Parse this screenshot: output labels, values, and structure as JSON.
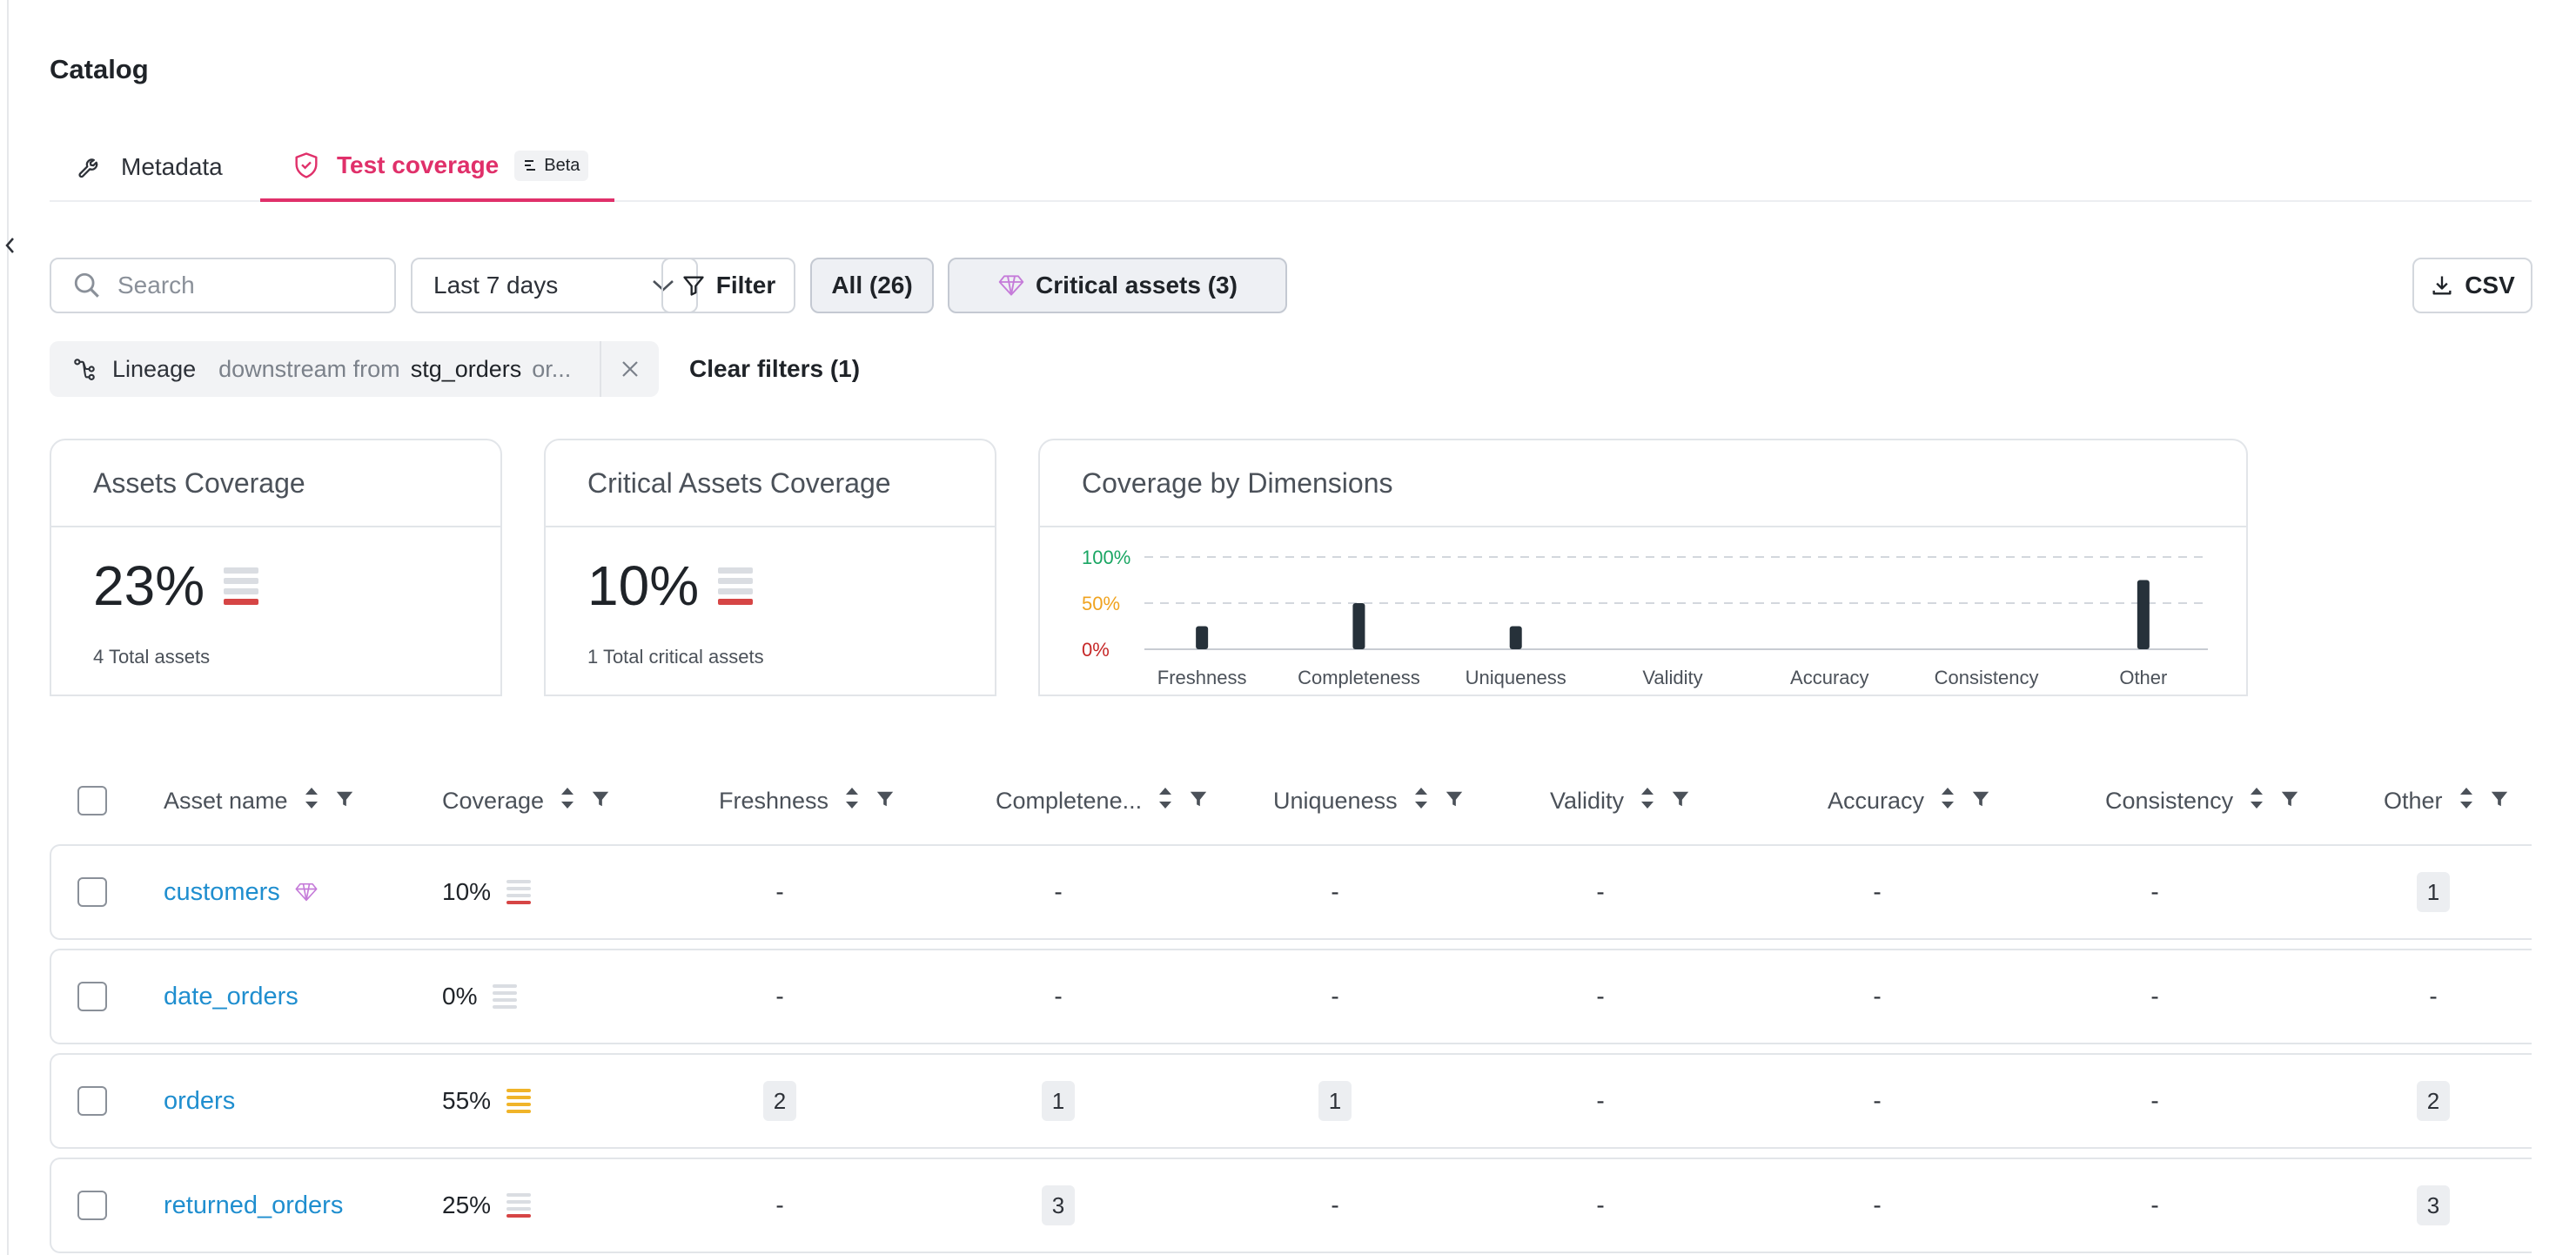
{
  "page": {
    "title": "Catalog"
  },
  "tabs": [
    {
      "label": "Metadata",
      "icon": "wrench-icon"
    },
    {
      "label": "Test coverage",
      "icon": "shield-check-icon",
      "badge": "Beta",
      "active": true
    }
  ],
  "toolbar": {
    "search_placeholder": "Search",
    "date_range": "Last 7 days",
    "filter_label": "Filter",
    "all_label": "All (26)",
    "critical_label": "Critical assets (3)",
    "csv_label": "CSV"
  },
  "active_filter": {
    "key": "Lineage",
    "relation": "downstream from",
    "value": "stg_orders",
    "more": "or...",
    "clear_label": "Clear filters (1)"
  },
  "cards": {
    "assets": {
      "title": "Assets Coverage",
      "value": "23%",
      "subtitle": "4 Total assets",
      "level": 0.23
    },
    "critical": {
      "title": "Critical Assets Coverage",
      "value": "10%",
      "subtitle": "1 Total critical assets",
      "level": 0.1
    },
    "dimensions": {
      "title": "Coverage by Dimensions"
    }
  },
  "chart_data": {
    "type": "bar",
    "categories": [
      "Freshness",
      "Completeness",
      "Uniqueness",
      "Validity",
      "Accuracy",
      "Consistency",
      "Other"
    ],
    "values": [
      25,
      50,
      25,
      0,
      0,
      0,
      75
    ],
    "ylim": [
      0,
      100
    ],
    "yticks": [
      "0%",
      "50%",
      "100%"
    ],
    "ytick_colors": [
      "#c62828",
      "#f0a31f",
      "#1aa663"
    ],
    "grid": true,
    "bar_color": "#26313a",
    "title": "",
    "xlabel": "",
    "ylabel": ""
  },
  "table": {
    "columns": [
      "Asset name",
      "Coverage",
      "Freshness",
      "Completene...",
      "Uniqueness",
      "Validity",
      "Accuracy",
      "Consistency",
      "Other"
    ],
    "rows": [
      {
        "name": "customers",
        "critical": true,
        "coverage": "10%",
        "coverage_level": "low",
        "cells": [
          "-",
          "-",
          "-",
          "-",
          "-",
          "-",
          "1"
        ]
      },
      {
        "name": "date_orders",
        "critical": false,
        "coverage": "0%",
        "coverage_level": "none",
        "cells": [
          "-",
          "-",
          "-",
          "-",
          "-",
          "-",
          "-"
        ]
      },
      {
        "name": "orders",
        "critical": false,
        "coverage": "55%",
        "coverage_level": "mid",
        "cells": [
          "2",
          "1",
          "1",
          "-",
          "-",
          "-",
          "2"
        ]
      },
      {
        "name": "returned_orders",
        "critical": false,
        "coverage": "25%",
        "coverage_level": "low",
        "cells": [
          "-",
          "3",
          "-",
          "-",
          "-",
          "-",
          "3"
        ]
      }
    ]
  },
  "colors": {
    "accent": "#e0306a",
    "link": "#1f8ecf",
    "meter_red": "#d64545",
    "meter_yellow": "#f0b429"
  }
}
